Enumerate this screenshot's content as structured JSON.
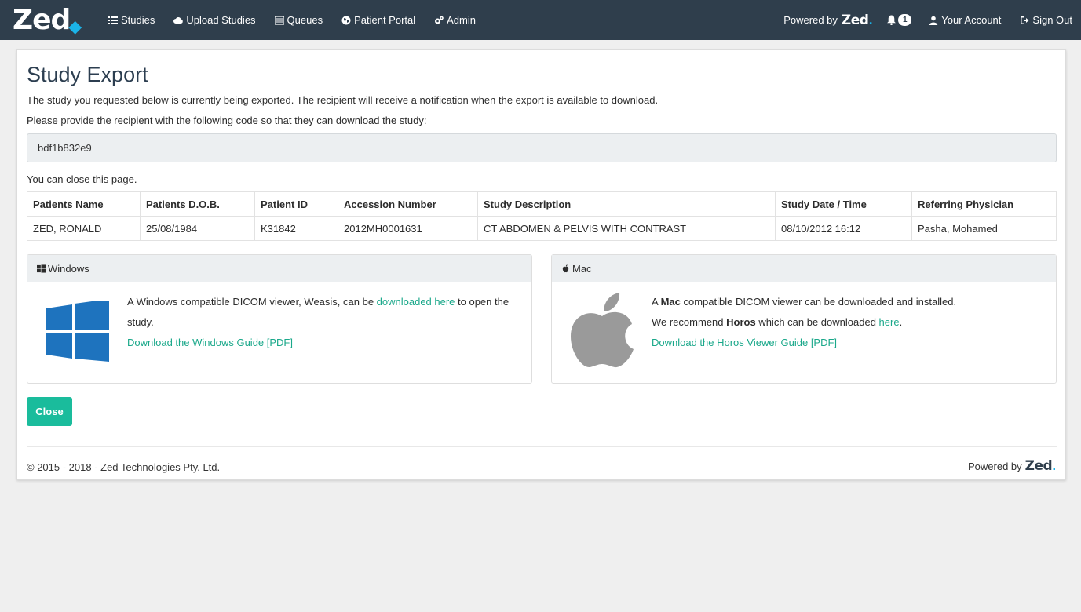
{
  "navbar": {
    "brand": "Zed",
    "items": [
      {
        "label": "Studies",
        "icon": "list-icon"
      },
      {
        "label": "Upload Studies",
        "icon": "cloud-upload-icon"
      },
      {
        "label": "Queues",
        "icon": "list-alt-icon"
      },
      {
        "label": "Patient Portal",
        "icon": "globe-icon"
      },
      {
        "label": "Admin",
        "icon": "cogs-icon"
      }
    ],
    "powered_by": "Powered by",
    "powered_brand": "Zed",
    "notifications_count": "1",
    "account": "Your Account",
    "sign_out": "Sign Out"
  },
  "main": {
    "title": "Study Export",
    "message": "The study you requested below is currently being exported. The recipient will receive a notification when the export is available to download.",
    "code_prompt": "Please provide the recipient with the following code so that they can download the study:",
    "code": "bdf1b832e9",
    "close_note": "You can close this page."
  },
  "table": {
    "headers": [
      "Patients Name",
      "Patients D.O.B.",
      "Patient ID",
      "Accession Number",
      "Study Description",
      "Study Date / Time",
      "Referring Physician"
    ],
    "rows": [
      [
        "ZED, RONALD",
        "25/08/1984",
        "K31842",
        "2012MH0001631",
        "CT ABDOMEN & PELVIS WITH CONTRAST",
        "08/10/2012 16:12",
        "Pasha, Mohamed"
      ]
    ]
  },
  "windows_panel": {
    "heading": "Windows",
    "text_before": "A Windows compatible DICOM viewer, Weasis, can be ",
    "link": "downloaded here",
    "text_after": " to open the study.",
    "guide_link": "Download the Windows Guide [PDF]",
    "logo_color": "#1e73be"
  },
  "mac_panel": {
    "heading": "Mac",
    "line1_a": "A ",
    "line1_bold": "Mac",
    "line1_b": " compatible DICOM viewer can be downloaded and installed.",
    "line2_a": "We recommend ",
    "line2_bold": "Horos",
    "line2_b": " which can be downloaded ",
    "line2_link": "here",
    "line2_end": ".",
    "guide_link": "Download the Horos Viewer Guide [PDF]",
    "logo_color": "#9a9a9a"
  },
  "close_button": "Close",
  "footer": {
    "copyright": "© 2015 - 2018 - Zed Technologies Pty. Ltd.",
    "powered_by": "Powered by",
    "powered_brand": "Zed"
  },
  "colors": {
    "navbar": "#2f3e4c",
    "accent": "#1abc9c",
    "link": "#1aa88a",
    "brand_dot": "#1bb3e8"
  }
}
